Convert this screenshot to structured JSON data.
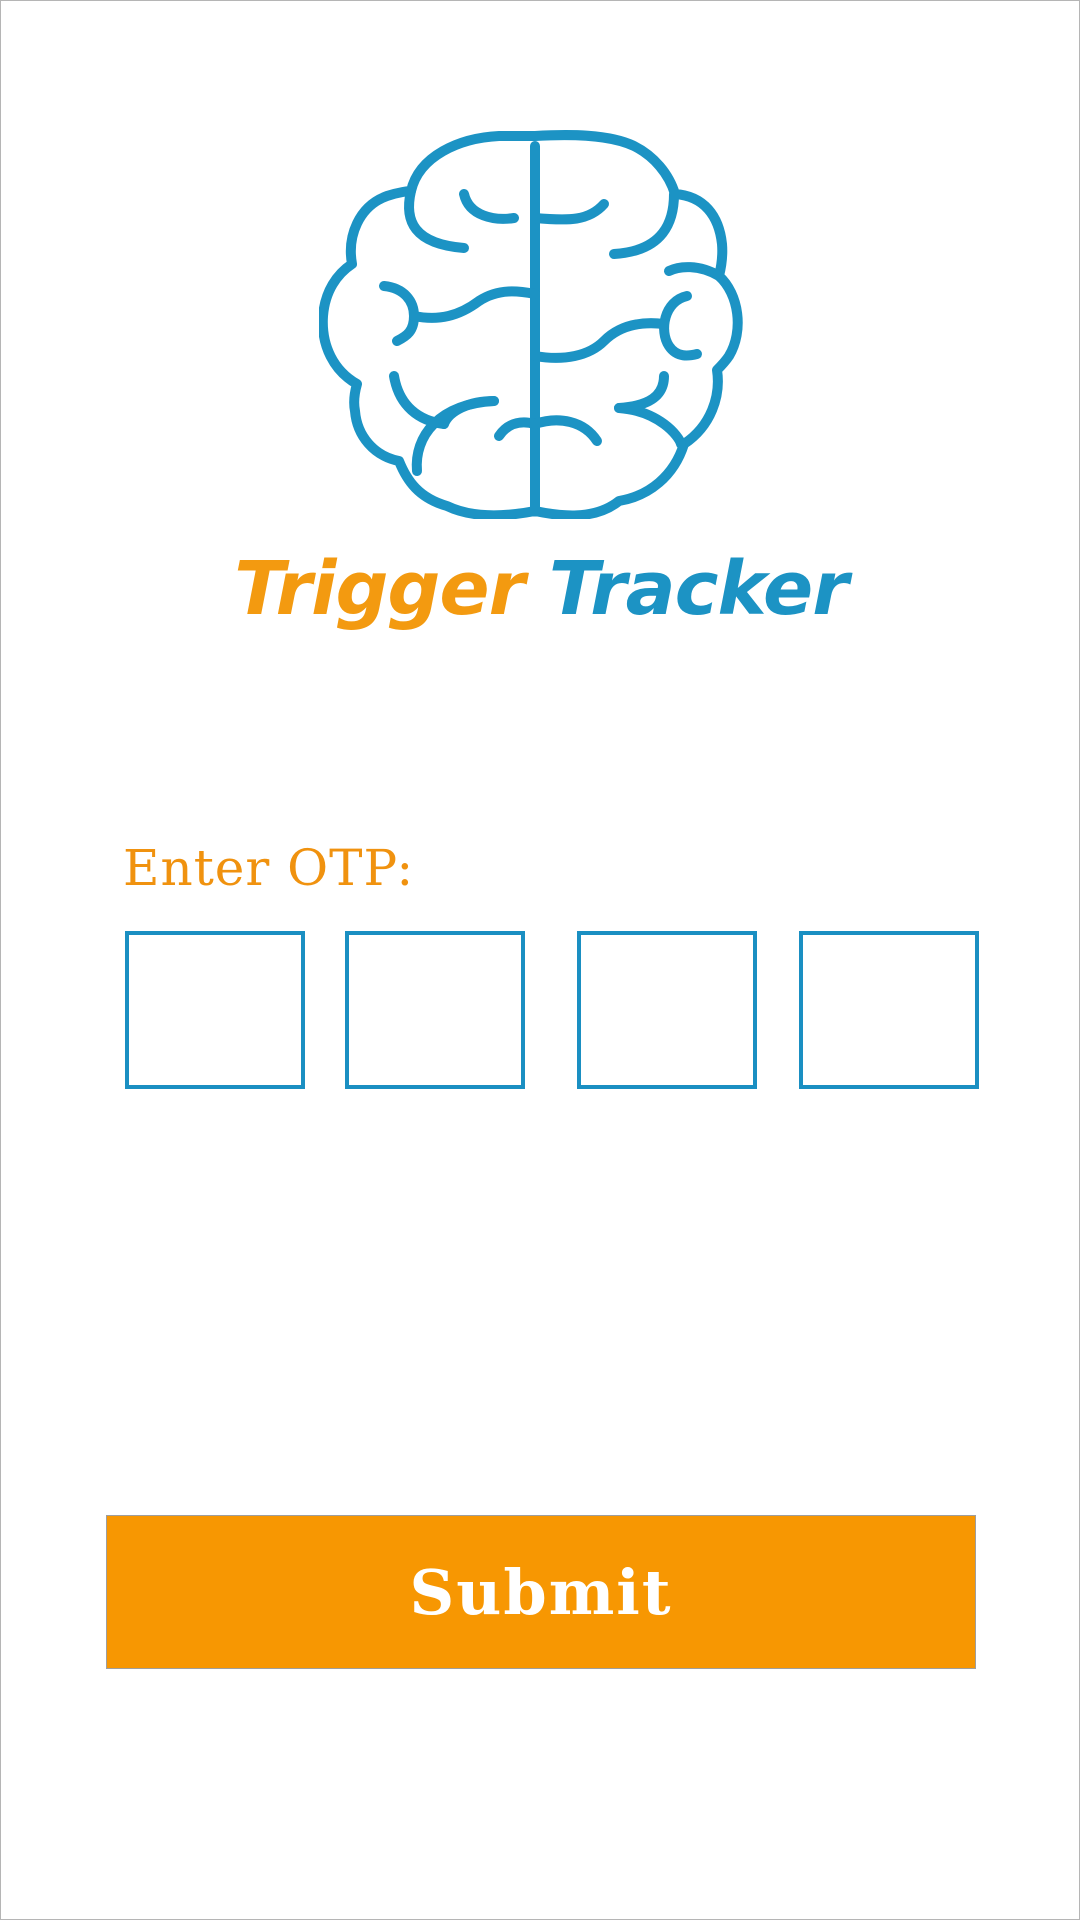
{
  "app": {
    "title_part1": "Trigger",
    "title_part2": "Tracker",
    "logo_icon": "brain-icon"
  },
  "otp": {
    "label": "Enter OTP:",
    "digits": [
      "",
      "",
      "",
      ""
    ]
  },
  "actions": {
    "submit_label": "Submit"
  },
  "colors": {
    "brand_blue": "#1c93c4",
    "brand_orange": "#f39a10",
    "label_orange": "#f0920f",
    "button_orange": "#f79702",
    "box_border_blue": "#1a8fc2"
  }
}
